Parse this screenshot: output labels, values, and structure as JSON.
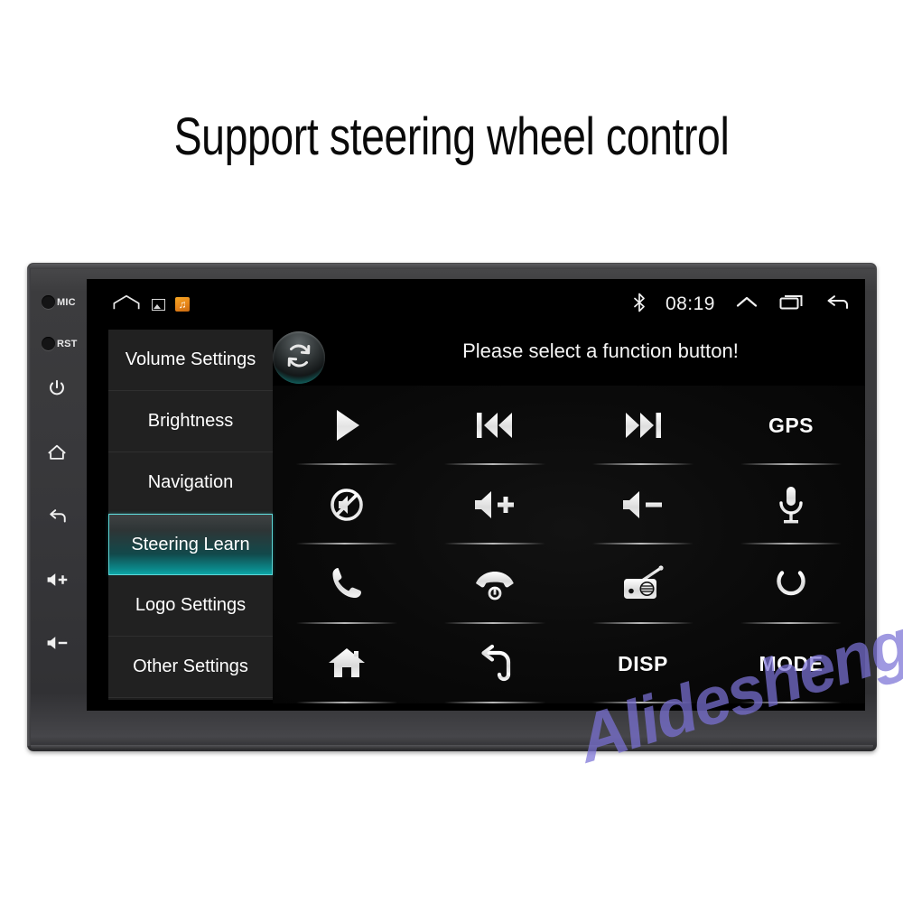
{
  "headline": "Support steering wheel control",
  "watermark": "Alidesheng",
  "device": {
    "bezel": {
      "mic_label": "MIC",
      "rst_label": "RST",
      "buttons": [
        {
          "name": "power",
          "label": ""
        },
        {
          "name": "home",
          "label": ""
        },
        {
          "name": "back",
          "label": ""
        },
        {
          "name": "volume-up",
          "label": "+"
        },
        {
          "name": "volume-down",
          "label": "-"
        }
      ]
    }
  },
  "statusbar": {
    "home_icon": "home-outline-icon",
    "notifications": [
      {
        "icon": "gallery-notification-icon"
      },
      {
        "icon": "music-notification-icon",
        "glyph": "♫"
      }
    ],
    "bluetooth_icon": "bluetooth-icon",
    "clock": "08:19",
    "expand_icon": "chevron-up-icon",
    "recents_icon": "recents-icon",
    "back_icon": "back-arrow-icon"
  },
  "menu": {
    "items": [
      {
        "label": "Volume Settings",
        "selected": false
      },
      {
        "label": "Brightness",
        "selected": false
      },
      {
        "label": "Navigation",
        "selected": false
      },
      {
        "label": "Steering Learn",
        "selected": true
      },
      {
        "label": "Logo Settings",
        "selected": false
      },
      {
        "label": "Other Settings",
        "selected": false
      }
    ]
  },
  "content": {
    "sync_icon": "sync-refresh-icon",
    "hint": "Please select a function button!",
    "buttons": [
      {
        "name": "play",
        "type": "icon",
        "label": ""
      },
      {
        "name": "previous-track",
        "type": "icon",
        "label": ""
      },
      {
        "name": "next-track",
        "type": "icon",
        "label": ""
      },
      {
        "name": "gps",
        "type": "text",
        "label": "GPS"
      },
      {
        "name": "mute",
        "type": "icon",
        "label": ""
      },
      {
        "name": "volume-up",
        "type": "icon",
        "label": ""
      },
      {
        "name": "volume-down",
        "type": "icon",
        "label": ""
      },
      {
        "name": "microphone",
        "type": "icon",
        "label": ""
      },
      {
        "name": "call-answer",
        "type": "icon",
        "label": ""
      },
      {
        "name": "call-hangup",
        "type": "icon",
        "label": ""
      },
      {
        "name": "radio",
        "type": "icon",
        "label": ""
      },
      {
        "name": "power",
        "type": "icon",
        "label": ""
      },
      {
        "name": "home",
        "type": "icon",
        "label": ""
      },
      {
        "name": "back",
        "type": "icon",
        "label": ""
      },
      {
        "name": "display",
        "type": "text",
        "label": "DISP"
      },
      {
        "name": "mode",
        "type": "text",
        "label": "MODE"
      }
    ]
  },
  "colors": {
    "accent_teal": "#0ea7a8",
    "screen_black": "#000000",
    "bezel_gray": "#37373a",
    "watermark_purple": "#7b72d6"
  }
}
